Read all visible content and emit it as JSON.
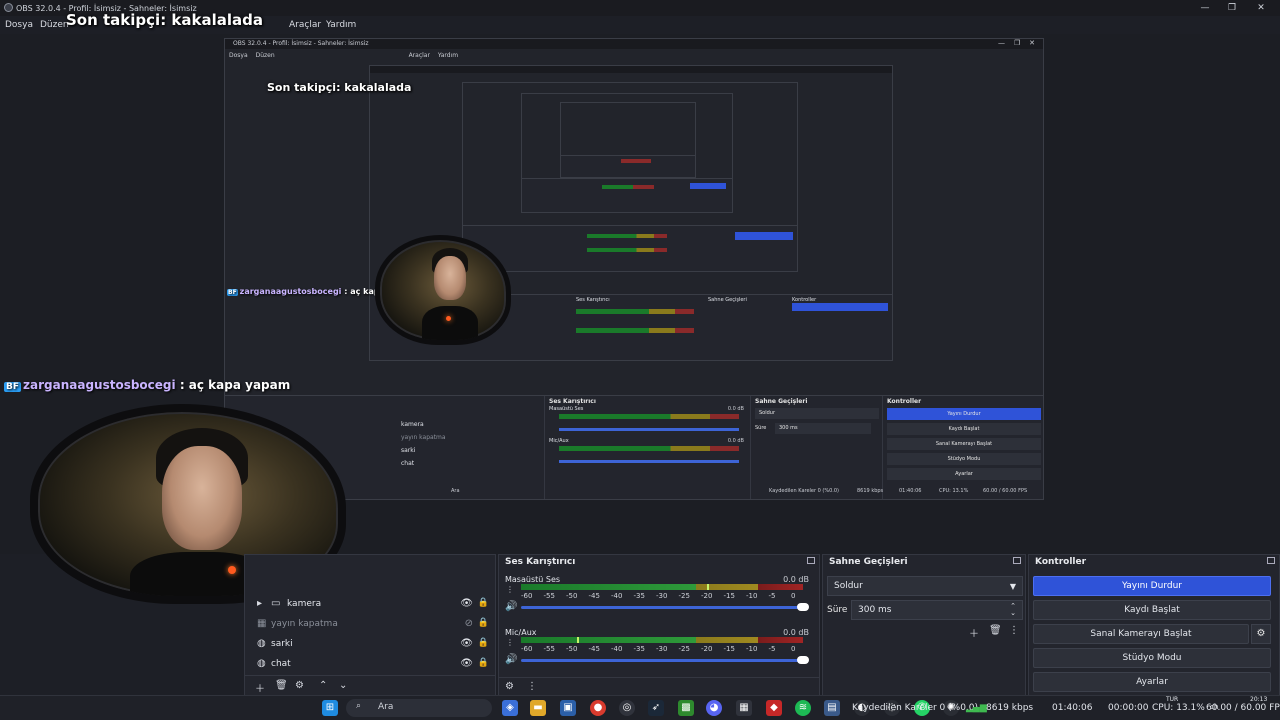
{
  "window": {
    "title": "OBS 32.0.4 - Profil: İsimsiz - Sahneler: İsimsiz",
    "controls": [
      "—",
      "❐",
      "✕"
    ]
  },
  "menu": [
    "Dosya",
    "Düzen",
    "Araçlar",
    "Yardım"
  ],
  "overlay": {
    "latest_follower": "Son takipçi: kakalalada",
    "chat_user": "zarganaagustosbocegi",
    "chat_sep": " : ",
    "chat_message": "aç kapa yapam",
    "chat_icon": "BF"
  },
  "nested": {
    "title": "OBS 32.0.4 - Profil: İsimsiz - Sahneler: İsimsiz",
    "menu": [
      "Dosya",
      "Düzen",
      "Araçlar",
      "Yardım"
    ],
    "follower": "Son takipçi: kakalalada",
    "chat_user": "zarganaagustosbocegi",
    "chat_message": "aç kapa yapam",
    "mixer_title": "Ses Karıştırıcı",
    "transitions_title": "Sahne Geçişleri",
    "controls_title": "Kontroller",
    "sources": [
      "kamera",
      "yayın kapatma",
      "sarki",
      "chat"
    ],
    "buttons": [
      "Yayını Durdur",
      "Kaydı Başlat",
      "Sanal Kamerayı Başlat",
      "Stüdyo Modu",
      "Ayarlar"
    ],
    "transition": "Soldur",
    "duration_label": "Süre",
    "duration": "300 ms",
    "search": "Ara",
    "status": "Kaydedilen Kareler 0 (%0.0)",
    "bitrate": "8619 kbps",
    "time": "01:40:06",
    "mixer_channels": [
      {
        "name": "Masaüstü Ses",
        "db": "0.0 dB"
      },
      {
        "name": "Mic/Aux",
        "db": "0.0 dB"
      }
    ],
    "cpu": "CPU: 13.1%",
    "fps": "60.00 / 60.00 FPS"
  },
  "sources": {
    "items": [
      {
        "label": "kamera",
        "icon": "folder-icon",
        "dim": false,
        "expandable": true
      },
      {
        "label": "yayın kapatma",
        "icon": "image-icon",
        "dim": true,
        "expandable": false
      },
      {
        "label": "sarki",
        "icon": "globe-icon",
        "dim": false,
        "expandable": false
      },
      {
        "label": "chat",
        "icon": "globe-icon",
        "dim": false,
        "expandable": false
      }
    ]
  },
  "mixer": {
    "title": "Ses Karıştırıcı",
    "channels": [
      {
        "name": "Masaüstü Ses",
        "db": "0.0 dB",
        "peak": 0.66
      },
      {
        "name": "Mic/Aux",
        "db": "0.0 dB",
        "peak": 0.2
      }
    ],
    "ticks": [
      "-60",
      "-55",
      "-50",
      "-45",
      "-40",
      "-35",
      "-30",
      "-25",
      "-20",
      "-15",
      "-10",
      "-5",
      "0"
    ]
  },
  "transitions": {
    "title": "Sahne Geçişleri",
    "selected": "Soldur",
    "duration_label": "Süre",
    "duration_value": "300 ms"
  },
  "controls": {
    "title": "Kontroller",
    "buttons": [
      "Yayını Durdur",
      "Kaydı Başlat",
      "Sanal Kamerayı Başlat",
      "Stüdyo Modu",
      "Ayarlar"
    ]
  },
  "status": {
    "frames": "Kaydedilen Kareler 0 (%0.0)",
    "bitrate": "8619 kbps",
    "live_time": "01:40:06",
    "rec_time": "00:00:00",
    "cpu": "CPU: 13.1%",
    "fps": "60.00 / 60.00 FPS"
  },
  "taskbar": {
    "search_placeholder": "Ara",
    "lang": "TUR",
    "lang_sub": "TRQ",
    "clock_time": "20:13",
    "clock_date": "8.05.2025",
    "ch": "ch"
  },
  "colors": {
    "accent": "#2f53d8",
    "bg": "#1d1f26",
    "panel": "#23252d"
  }
}
